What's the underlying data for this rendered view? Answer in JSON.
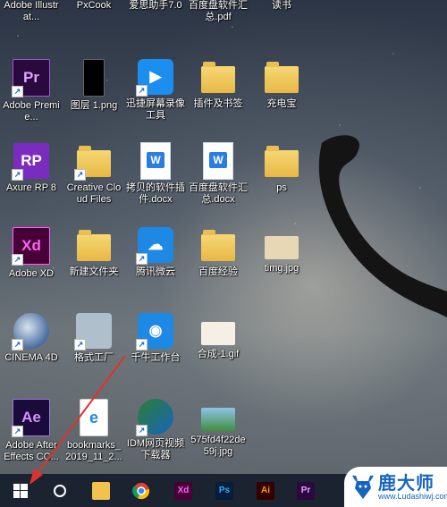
{
  "desktop": {
    "icons": [
      {
        "label": "Adobe Illustrat...",
        "icon": "illustrator-icon"
      },
      {
        "label": "PxCook",
        "icon": "pxcook-icon"
      },
      {
        "label": "爱思助手7.0",
        "icon": "aisi-icon"
      },
      {
        "label": "百度盘软件汇总.pdf",
        "icon": "pdf-icon"
      },
      {
        "label": "读书",
        "icon": "folder-icon"
      },
      {
        "label": "Adobe Premie...",
        "icon": "premiere-icon"
      },
      {
        "label": "图层 1.png",
        "icon": "image-icon"
      },
      {
        "label": "迅捷屏幕录像工具",
        "icon": "screen-recorder-icon"
      },
      {
        "label": "插件及书签",
        "icon": "folder-icon"
      },
      {
        "label": "充电宝",
        "icon": "folder-icon"
      },
      {
        "label": "Axure RP 8",
        "icon": "axure-icon"
      },
      {
        "label": "Creative Cloud Files",
        "icon": "creative-cloud-folder-icon"
      },
      {
        "label": "拷贝的软件插件.docx",
        "icon": "word-doc-icon"
      },
      {
        "label": "百度盘软件汇总.docx",
        "icon": "word-doc-icon"
      },
      {
        "label": "ps",
        "icon": "folder-icon"
      },
      {
        "label": "Adobe XD",
        "icon": "xd-icon"
      },
      {
        "label": "新建文件夹",
        "icon": "folder-icon"
      },
      {
        "label": "腾讯微云",
        "icon": "weiyun-icon"
      },
      {
        "label": "百度经验",
        "icon": "folder-icon"
      },
      {
        "label": "timg.jpg",
        "icon": "image-icon"
      },
      {
        "label": "CINEMA 4D",
        "icon": "cinema4d-icon"
      },
      {
        "label": "格式工厂",
        "icon": "format-factory-icon"
      },
      {
        "label": "千牛工作台",
        "icon": "qianniu-icon"
      },
      {
        "label": "合成-1.gif",
        "icon": "gif-icon"
      },
      {
        "label": "Adobe After Effects CC...",
        "icon": "after-effects-icon"
      },
      {
        "label": "bookmarks_2019_11_2...",
        "icon": "html-file-icon"
      },
      {
        "label": "IDM网页视频下载器",
        "icon": "idm-icon"
      },
      {
        "label": "575fd4f22de59j.jpg",
        "icon": "image-icon"
      }
    ]
  },
  "taskbar": {
    "items": [
      {
        "name": "start-button",
        "icon": "windows-logo-icon"
      },
      {
        "name": "search-button",
        "icon": "cortana-circle-icon"
      },
      {
        "name": "file-explorer-button",
        "icon": "folder-icon"
      },
      {
        "name": "chrome-button",
        "icon": "chrome-icon"
      },
      {
        "name": "xd-button",
        "icon": "xd-icon",
        "text": "Xd"
      },
      {
        "name": "photoshop-button",
        "icon": "photoshop-icon",
        "text": "Ps"
      },
      {
        "name": "illustrator-button",
        "icon": "illustrator-icon",
        "text": "Ai"
      },
      {
        "name": "premiere-button",
        "icon": "premiere-icon",
        "text": "Pr"
      }
    ]
  },
  "watermark": {
    "title": "鹿大师",
    "url": "www.Ludashiwj.com"
  },
  "colors": {
    "premiere": "#2a0a3e",
    "premiere_text": "#e6a2ff",
    "xd": "#470137",
    "xd_text": "#ff61f6",
    "ae": "#1a0b3b",
    "ae_text": "#d291ff",
    "axure": "#7b2cbf",
    "taskbar": "#1b2230",
    "arrow": "#e0322d",
    "watermark_blue": "#1565c0"
  },
  "glyphs": {
    "premiere": "Pr",
    "xd": "Xd",
    "after_effects": "Ae",
    "axure": "RP",
    "word": "W",
    "shortcut": "↗"
  }
}
